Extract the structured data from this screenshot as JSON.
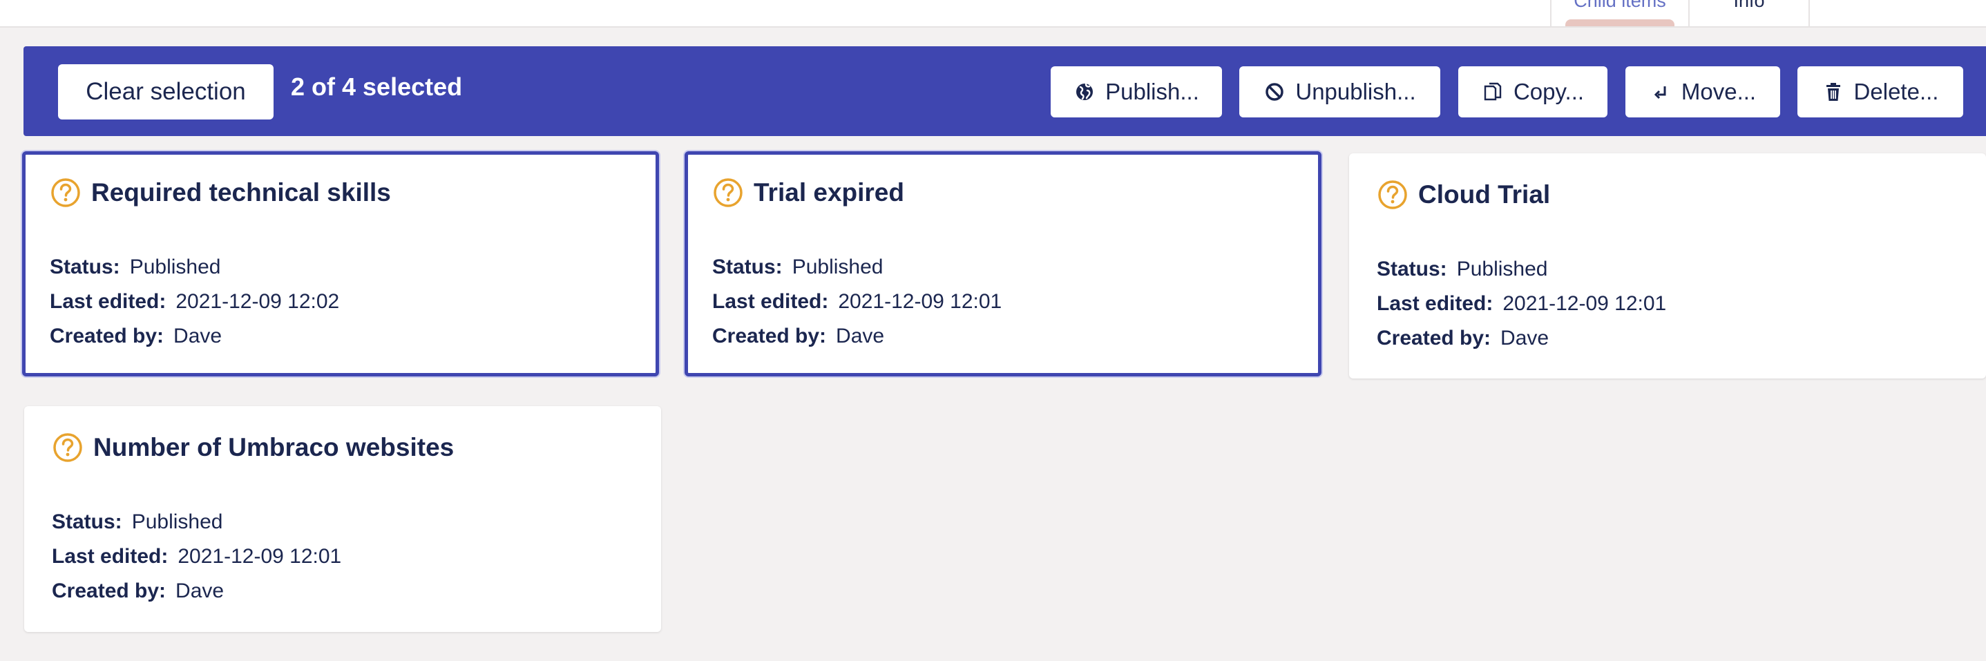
{
  "tabs": {
    "child_items": "Child items",
    "info": "Info"
  },
  "selection_bar": {
    "clear_label": "Clear selection",
    "count_text": "2 of 4 selected",
    "actions": {
      "publish": "Publish...",
      "unpublish": "Unpublish...",
      "copy": "Copy...",
      "move": "Move...",
      "delete": "Delete..."
    }
  },
  "labels": {
    "status": "Status:",
    "last_edited": "Last edited:",
    "created_by": "Created by:"
  },
  "items": [
    {
      "name": "Required technical skills",
      "status": "Published",
      "last_edited": "2021-12-09 12:02",
      "created_by": "Dave",
      "selected": true,
      "icon": "question-circle-icon"
    },
    {
      "name": "Trial expired",
      "status": "Published",
      "last_edited": "2021-12-09 12:01",
      "created_by": "Dave",
      "selected": true,
      "icon": "question-circle-icon"
    },
    {
      "name": "Cloud Trial",
      "status": "Published",
      "last_edited": "2021-12-09 12:01",
      "created_by": "Dave",
      "selected": false,
      "icon": "question-circle-icon"
    },
    {
      "name": "Number of Umbraco websites",
      "status": "Published",
      "last_edited": "2021-12-09 12:01",
      "created_by": "Dave",
      "selected": false,
      "icon": "question-circle-icon"
    }
  ],
  "colors": {
    "accent": "#3f46b0",
    "icon_orange": "#e8a32e",
    "text": "#1b264f",
    "background": "#f3f1f1"
  }
}
